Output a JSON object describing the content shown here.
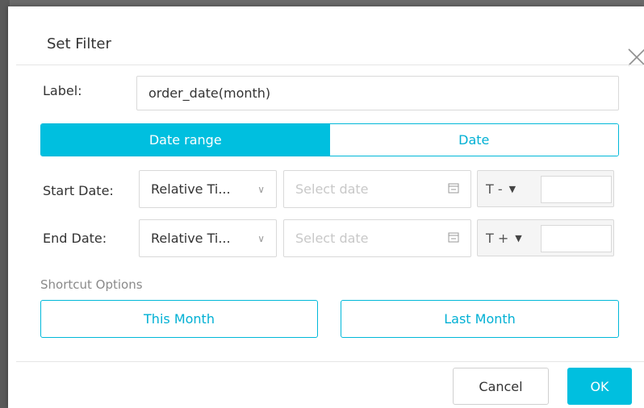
{
  "dialog": {
    "title": "Set Filter"
  },
  "label_field": {
    "label": "Label:",
    "value": "order_date(month)"
  },
  "mode_toggle": {
    "options": [
      "Date range",
      "Date"
    ],
    "selected": "Date range"
  },
  "start_date": {
    "label": "Start Date:",
    "type_select": "Relative Ti...",
    "date_placeholder": "Select date",
    "offset_operator": "T -",
    "offset_value": ""
  },
  "end_date": {
    "label": "End Date:",
    "type_select": "Relative Ti...",
    "date_placeholder": "Select date",
    "offset_operator": "T +",
    "offset_value": ""
  },
  "shortcuts": {
    "label": "Shortcut Options",
    "options": [
      "This Month",
      "Last Month"
    ]
  },
  "footer": {
    "cancel_label": "Cancel",
    "ok_label": "OK"
  },
  "colors": {
    "accent": "#00bfdf",
    "border": "#d9d9d9",
    "text": "#333333",
    "muted_text": "#8a8a8a"
  },
  "icons": {
    "close": "close-icon",
    "calendar": "calendar-icon",
    "chevron": "chevron-down-icon",
    "caret": "caret-down-icon"
  }
}
